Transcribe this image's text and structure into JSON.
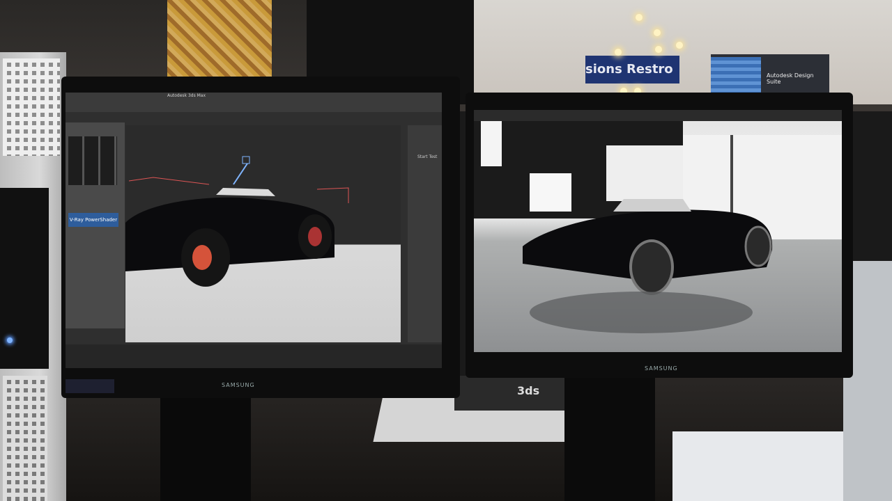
{
  "booth_sign": "sions  Restro",
  "kiosk_text": "Autodesk Design Suite",
  "left_monitor": {
    "brand": "SAMSUNG",
    "title": "Autodesk 3ds Max",
    "vray_label": "V-Ray PowerShader",
    "start_button": "Start Test"
  },
  "right_monitor": {
    "brand": "SAMSUNG"
  },
  "magazine_text": "3ds",
  "colors": {
    "car_body": "#0b0b0d",
    "vray_blue": "#2e5d9c",
    "booth_blue": "#1f3472",
    "pc_led": "#7fb4ff"
  }
}
